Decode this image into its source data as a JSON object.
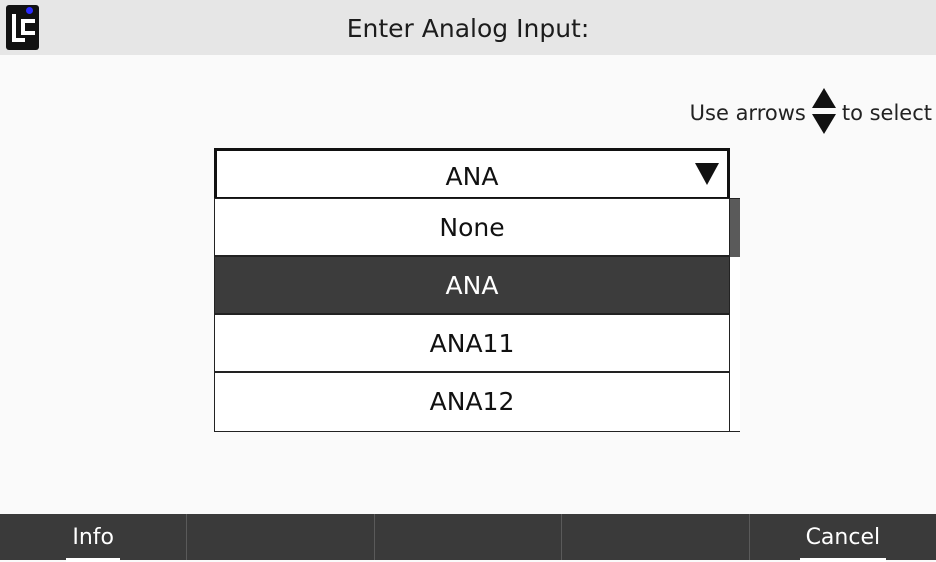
{
  "header": {
    "logo_text": "LC",
    "title": "Enter Analog Input:"
  },
  "hint": {
    "before": "Use arrows",
    "after": "to select",
    "icon": "up-down-arrows-icon"
  },
  "dropdown": {
    "value": "ANA",
    "caret_icon": "triangle-down-icon"
  },
  "options": [
    "None",
    "ANA",
    "ANA11",
    "ANA12"
  ],
  "selected_index": 1,
  "footer": {
    "buttons": [
      "Info",
      "",
      "",
      "",
      "Cancel"
    ]
  },
  "colors": {
    "header_bg": "#e6e6e6",
    "selected_bg": "#3c3c3c",
    "footer_bg": "#3a3a3a"
  }
}
